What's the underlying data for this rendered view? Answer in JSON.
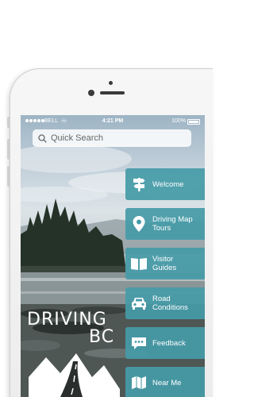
{
  "status_bar": {
    "carrier": "BELL",
    "time": "4:21 PM",
    "battery": "100%"
  },
  "search": {
    "placeholder": "Quick Search"
  },
  "logo": {
    "line1": "DRIVING",
    "line2": "BC"
  },
  "menu": {
    "items": [
      {
        "label": "Welcome",
        "icon": "signpost-icon"
      },
      {
        "label": "Driving Map\nTours",
        "icon": "map-pin-icon"
      },
      {
        "label": "Visitor\nGuides",
        "icon": "open-book-icon"
      },
      {
        "label": "Road\nConditions",
        "icon": "car-icon"
      },
      {
        "label": "Feedback",
        "icon": "speech-bubble-icon"
      },
      {
        "label": "Near Me",
        "icon": "folded-map-icon"
      }
    ]
  },
  "colors": {
    "menu_tile": "#469ba8",
    "status_text": "#ffffff"
  }
}
